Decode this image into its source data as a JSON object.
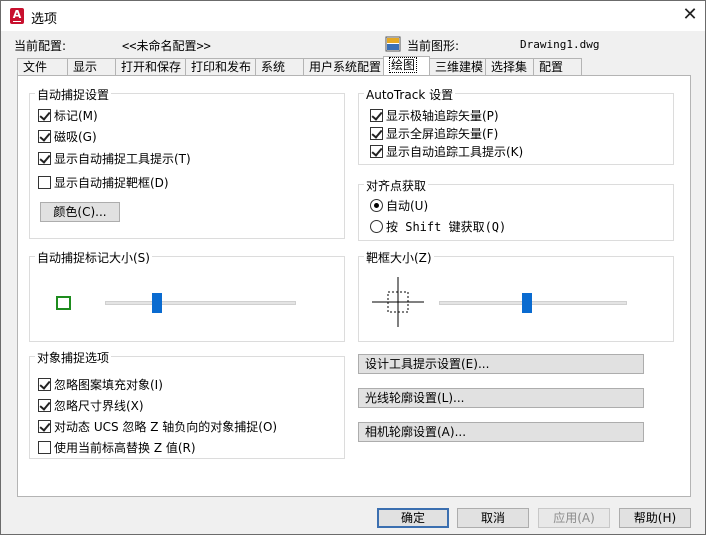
{
  "window": {
    "title": "选项",
    "close": "✕",
    "app_icon_letter": "A"
  },
  "profile": {
    "current_profile_label": "当前配置:",
    "current_profile_value": "<<未命名配置>>",
    "current_drawing_label": "当前图形:",
    "current_drawing_value": "Drawing1.dwg"
  },
  "tabs": [
    {
      "label": "文件"
    },
    {
      "label": "显示"
    },
    {
      "label": "打开和保存"
    },
    {
      "label": "打印和发布"
    },
    {
      "label": "系统"
    },
    {
      "label": "用户系统配置"
    },
    {
      "label": "绘图"
    },
    {
      "label": "三维建模"
    },
    {
      "label": "选择集"
    },
    {
      "label": "配置"
    }
  ],
  "active_tab": "绘图",
  "autosnap": {
    "title": "自动捕捉设置",
    "marker": {
      "label": "标记(M)",
      "checked": true
    },
    "magnet": {
      "label": "磁吸(G)",
      "checked": true
    },
    "tooltip": {
      "label": "显示自动捕捉工具提示(T)",
      "checked": true
    },
    "aperture": {
      "label": "显示自动捕捉靶框(D)",
      "checked": false
    },
    "color_button": "颜色(C)..."
  },
  "autotrack": {
    "title": "AutoTrack 设置",
    "polar": {
      "label": "显示极轴追踪矢量(P)",
      "checked": true
    },
    "fullscreen": {
      "label": "显示全屏追踪矢量(F)",
      "checked": true
    },
    "tooltip": {
      "label": "显示自动追踪工具提示(K)",
      "checked": true
    }
  },
  "alignment": {
    "title": "对齐点获取",
    "auto": {
      "label": "自动(U)",
      "selected": true
    },
    "shift": {
      "label": "按 Shift 键获取(Q)",
      "selected": false
    }
  },
  "marker_size": {
    "title": "自动捕捉标记大小(S)",
    "level": 0.27,
    "marker_color": "#1e8c1e"
  },
  "aperture_size": {
    "title": "靶框大小(Z)",
    "level": 0.47
  },
  "object_snap": {
    "title": "对象捕捉选项",
    "hatch": {
      "label": "忽略图案填充对象(I)",
      "checked": true
    },
    "dimext": {
      "label": "忽略尺寸界线(X)",
      "checked": true
    },
    "ucs": {
      "label": "对动态 UCS 忽略 Z 轴负向的对象捕捉(O)",
      "checked": true
    },
    "elev": {
      "label": "使用当前标高替换 Z 值(R)",
      "checked": false
    }
  },
  "buttons": {
    "design_tooltip": "设计工具提示设置(E)...",
    "light_glyph": "光线轮廓设置(L)...",
    "camera_glyph": "相机轮廓设置(A)...",
    "ok": "确定",
    "cancel": "取消",
    "apply": "应用(A)",
    "help": "帮助(H)"
  },
  "colors": {
    "slider_thumb": "#0a6bd0",
    "app_icon": "#c8102e",
    "default_button_border": "#3b6fb0"
  }
}
